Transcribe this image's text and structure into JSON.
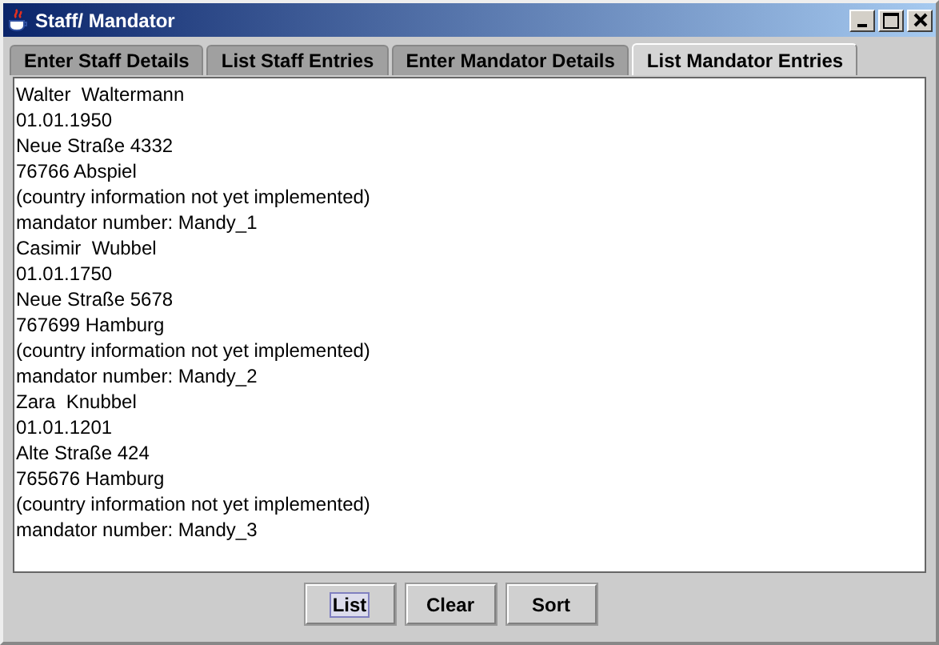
{
  "window": {
    "title": "Staff/ Mandator"
  },
  "tabs": [
    {
      "label": "Enter Staff Details",
      "selected": false
    },
    {
      "label": "List Staff Entries",
      "selected": false
    },
    {
      "label": "Enter Mandator Details",
      "selected": false
    },
    {
      "label": "List Mandator Entries",
      "selected": true
    }
  ],
  "text_area": {
    "lines": [
      "Walter  Waltermann",
      "01.01.1950",
      "Neue Straße 4332",
      "76766 Abspiel",
      "(country information not yet implemented)",
      "mandator number: Mandy_1",
      "Casimir  Wubbel",
      "01.01.1750",
      "Neue Straße 5678",
      "767699 Hamburg",
      "(country information not yet implemented)",
      "mandator number: Mandy_2",
      "Zara  Knubbel",
      "01.01.1201",
      "Alte Straße 424",
      "765676 Hamburg",
      "(country information not yet implemented)",
      "mandator number: Mandy_3"
    ]
  },
  "buttons": [
    {
      "label": "List",
      "focused": true
    },
    {
      "label": "Clear",
      "focused": false
    },
    {
      "label": "Sort",
      "focused": false
    }
  ]
}
